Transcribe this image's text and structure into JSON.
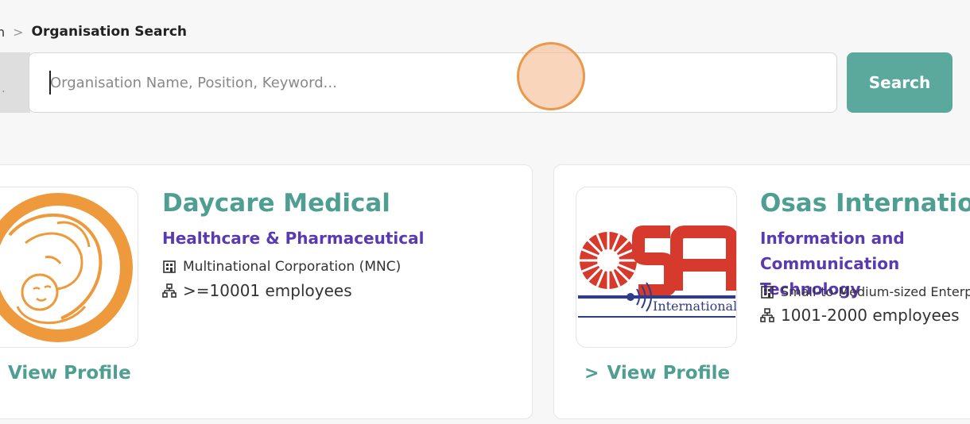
{
  "breadcrumb": {
    "previous": "n",
    "separator": ">",
    "current": "Organisation Search"
  },
  "search": {
    "placeholder": "Organisation Name, Position, Keyword...",
    "value": "",
    "button_label": "Search"
  },
  "organisations": [
    {
      "name": "Daycare Medical",
      "industry": "Healthcare & Pharmaceutical",
      "company_type": "Multinational Corporation (MNC)",
      "employees": ">=10001 employees",
      "view_profile_label": "View Profile",
      "logo": "mother-and-baby-logo"
    },
    {
      "name": "Osas International",
      "industry": "Information and Communication Technology",
      "company_type": "Small-to-Medium-sized Enterprise",
      "employees": "1001-2000 employees",
      "view_profile_label": "View Profile",
      "logo_text": "International",
      "logo": "osa-logo"
    }
  ],
  "colors": {
    "accent": "#5ba89c",
    "industry": "#5a3ab0",
    "cursor": "#e9994d"
  }
}
